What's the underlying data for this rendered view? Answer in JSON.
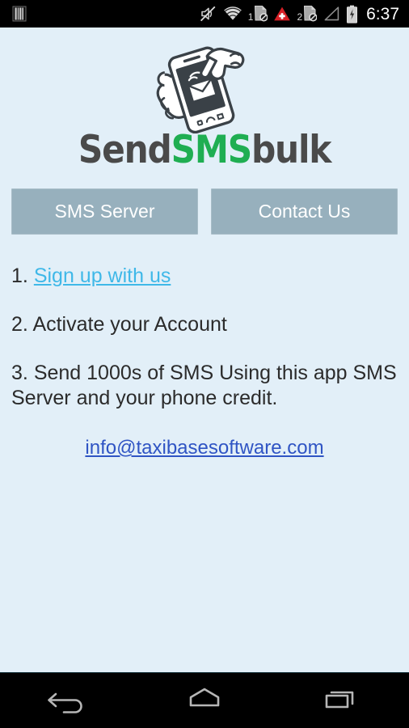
{
  "status_bar": {
    "left_icons": [
      {
        "name": "barcode-icon",
        "label": "barcode"
      }
    ],
    "right_icons": [
      {
        "name": "volume-mute-icon",
        "label": "silent mode"
      },
      {
        "name": "wifi-icon",
        "label": "wifi"
      },
      {
        "name": "sim1-no-service-icon",
        "label": "1",
        "number": "1"
      },
      {
        "name": "alert-triangle-icon",
        "label": "alert"
      },
      {
        "name": "sim2-no-service-icon",
        "label": "2",
        "number": "2"
      },
      {
        "name": "signal-empty-icon",
        "label": "no signal"
      },
      {
        "name": "battery-charging-icon",
        "label": "charging"
      }
    ],
    "clock": "6:37"
  },
  "logo": {
    "mark_name": "hand-holding-phone-envelope-icon",
    "wordmark_part1": "Send",
    "wordmark_part2": "SMS",
    "wordmark_part3": "bulk",
    "colors": {
      "dark": "#4a4a4a",
      "green": "#1fae52"
    }
  },
  "buttons": [
    {
      "name": "sms-server-button",
      "label": "SMS Server"
    },
    {
      "name": "contact-us-button",
      "label": "Contact Us"
    }
  ],
  "steps": [
    {
      "number": "1.",
      "link_text": "Sign up with us",
      "text": ""
    },
    {
      "number": "2.",
      "link_text": "",
      "text": "Activate your Account"
    },
    {
      "number": "3.",
      "link_text": "",
      "text": "Send 1000s of SMS Using this app SMS Server and your phone credit."
    }
  ],
  "contact": {
    "email": "info@taxibasesoftware.com"
  },
  "nav_bar": {
    "back": "back-icon",
    "home": "home-icon",
    "recents": "recents-icon"
  },
  "colors": {
    "app_background": "#e2eff8",
    "button_fill": "#97b0bd",
    "button_text": "#ffffff",
    "step_text": "#2b2b2b",
    "step_link": "#3fb8e8",
    "email_link": "#2f54c4",
    "status_bar": "#000000",
    "nav_bar": "#000000"
  }
}
